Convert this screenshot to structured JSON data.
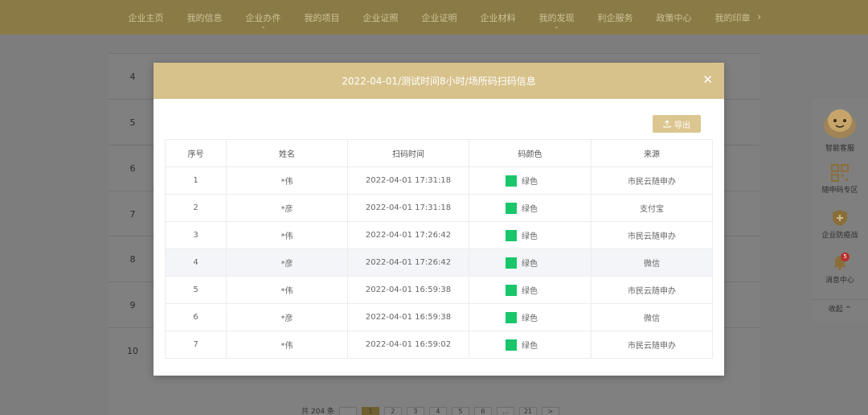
{
  "nav": {
    "items": [
      {
        "label": "企业主页",
        "caret": false
      },
      {
        "label": "我的信息",
        "caret": false
      },
      {
        "label": "企业办件",
        "caret": true
      },
      {
        "label": "我的项目",
        "caret": false
      },
      {
        "label": "企业证照",
        "caret": false
      },
      {
        "label": "企业证明",
        "caret": false
      },
      {
        "label": "企业材料",
        "caret": false
      },
      {
        "label": "我的发现",
        "caret": true
      },
      {
        "label": "利企服务",
        "caret": false
      },
      {
        "label": "政策中心",
        "caret": false
      },
      {
        "label": "我的印章",
        "caret": false
      }
    ],
    "more_icon": "chevron-right-icon"
  },
  "background_rows": [
    "4",
    "5",
    "6",
    "7",
    "8",
    "9",
    "10"
  ],
  "pagination": {
    "total_text": "共 204 条",
    "pages": [
      "",
      "1",
      "2",
      "3",
      "4",
      "5",
      "6",
      "...",
      "21",
      ">"
    ],
    "active_index": 1
  },
  "float_panel": {
    "items": [
      {
        "label": "智能客服",
        "icon": "robot-assistant-icon"
      },
      {
        "label": "随申码专区",
        "icon": "qr-code-icon"
      },
      {
        "label": "企业防疫战",
        "icon": "shield-plus-icon"
      },
      {
        "label": "消息中心",
        "icon": "bell-icon",
        "badge": "5"
      },
      {
        "label": "收起 ^",
        "icon": "collapse-icon"
      }
    ]
  },
  "modal": {
    "title": "2022-04-01/测试时间8小时/场所码扫码信息",
    "close_icon": "close-icon",
    "export_label": "导出",
    "export_icon": "upload-icon",
    "columns": [
      "序号",
      "姓名",
      "扫码时间",
      "码颜色",
      "来源"
    ],
    "rows": [
      {
        "no": "1",
        "name": "*伟",
        "time": "2022-04-01 17:31:18",
        "color": "绿色",
        "source": "市民云随申办"
      },
      {
        "no": "2",
        "name": "*彦",
        "time": "2022-04-01 17:31:18",
        "color": "绿色",
        "source": "支付宝"
      },
      {
        "no": "3",
        "name": "*伟",
        "time": "2022-04-01 17:26:42",
        "color": "绿色",
        "source": "市民云随申办"
      },
      {
        "no": "4",
        "name": "*彦",
        "time": "2022-04-01 17:26:42",
        "color": "绿色",
        "source": "微信"
      },
      {
        "no": "5",
        "name": "*伟",
        "time": "2022-04-01 16:59:38",
        "color": "绿色",
        "source": "市民云随申办"
      },
      {
        "no": "6",
        "name": "*彦",
        "time": "2022-04-01 16:59:38",
        "color": "绿色",
        "source": "微信"
      },
      {
        "no": "7",
        "name": "*伟",
        "time": "2022-04-01 16:59:02",
        "color": "绿色",
        "source": "市民云随申办"
      }
    ],
    "highlighted_row": 3,
    "green_color": "#19c66a"
  },
  "colors": {
    "nav_bg": "#8a7a45",
    "modal_header": "#d7c28c",
    "export_button": "#dcc690"
  }
}
